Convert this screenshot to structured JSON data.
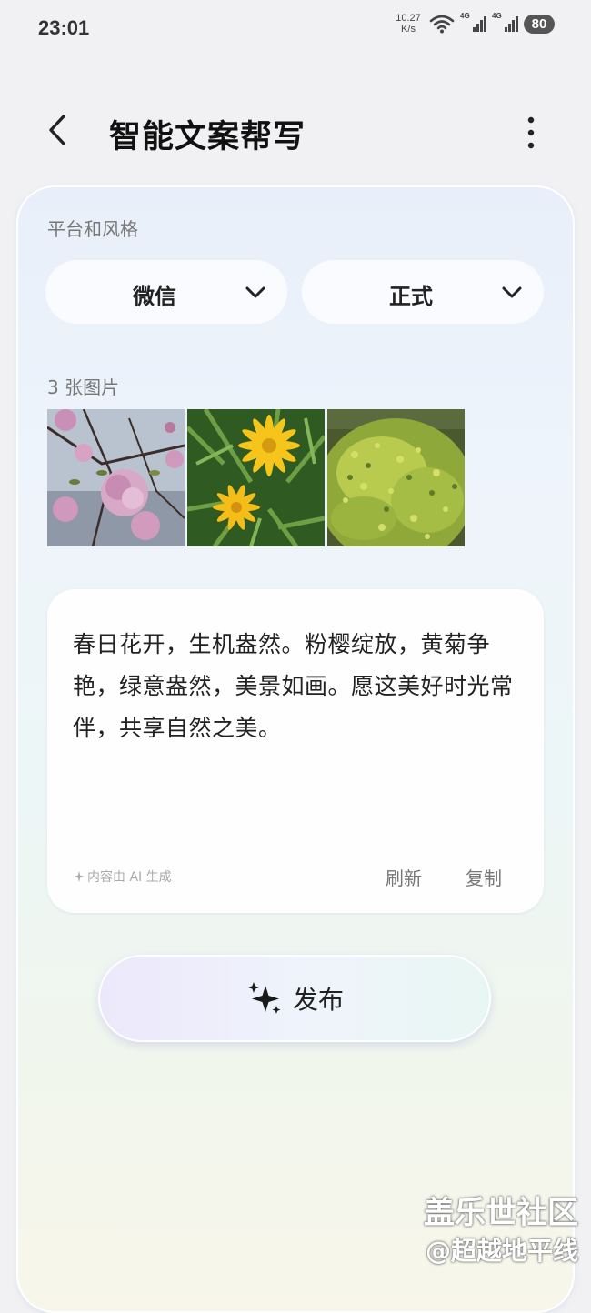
{
  "status_bar": {
    "time": "23:01",
    "net_speed_value": "10.27",
    "net_speed_unit": "K/s",
    "signal_1_label": "4G",
    "signal_2_label": "4G",
    "battery": "80"
  },
  "header": {
    "title": "智能文案帮写"
  },
  "platform_section": {
    "label": "平台和风格",
    "platform_value": "微信",
    "style_value": "正式"
  },
  "images_section": {
    "label": "3 张图片",
    "items": [
      {
        "icon": "cherry-blossom-photo"
      },
      {
        "icon": "yellow-daisy-photo"
      },
      {
        "icon": "green-shrub-photo"
      }
    ]
  },
  "generated": {
    "text": "春日花开，生机盎然。粉樱绽放，黄菊争艳，绿意盎然，美景如画。愿这美好时光常伴，共享自然之美。",
    "ai_note": "内容由 AI 生成",
    "refresh_label": "刷新",
    "copy_label": "复制"
  },
  "publish": {
    "label": "发布"
  },
  "watermark": {
    "line1": "盖乐世社区",
    "line2": "@超越地平线"
  },
  "colors": {
    "title": "#111111",
    "card_top": "#e9effa",
    "card_bottom": "#f8f6ea"
  }
}
